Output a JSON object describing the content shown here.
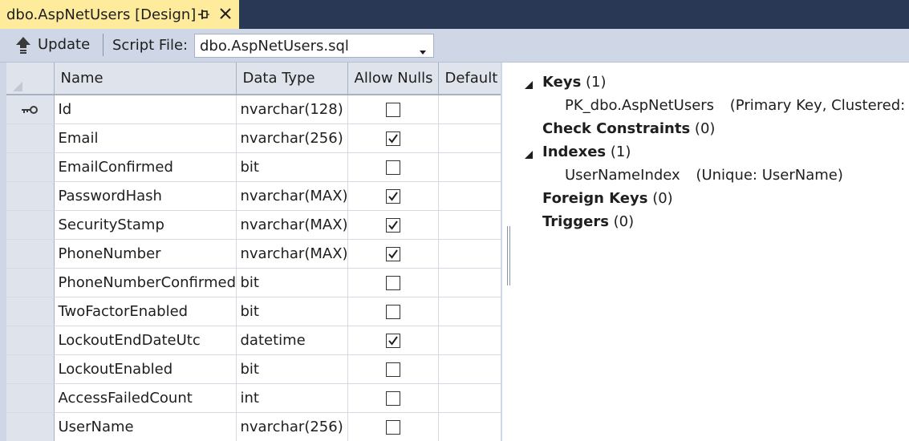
{
  "tab": {
    "title": "dbo.AspNetUsers [Design]",
    "pin_icon": "pin-icon",
    "close_icon": "close-icon"
  },
  "toolbar": {
    "update_label": "Update",
    "update_icon": "upload-arrow-icon",
    "script_file_label": "Script File:",
    "script_file_value": "dbo.AspNetUsers.sql"
  },
  "grid": {
    "headers": {
      "name": "Name",
      "data_type": "Data Type",
      "allow_nulls": "Allow Nulls",
      "default": "Default"
    },
    "rows": [
      {
        "name": "Id",
        "type": "nvarchar(128)",
        "nulls": false,
        "key": true
      },
      {
        "name": "Email",
        "type": "nvarchar(256)",
        "nulls": true,
        "key": false
      },
      {
        "name": "EmailConfirmed",
        "type": "bit",
        "nulls": false,
        "key": false
      },
      {
        "name": "PasswordHash",
        "type": "nvarchar(MAX)",
        "nulls": true,
        "key": false
      },
      {
        "name": "SecurityStamp",
        "type": "nvarchar(MAX)",
        "nulls": true,
        "key": false
      },
      {
        "name": "PhoneNumber",
        "type": "nvarchar(MAX)",
        "nulls": true,
        "key": false
      },
      {
        "name": "PhoneNumberConfirmed",
        "type": "bit",
        "nulls": false,
        "key": false
      },
      {
        "name": "TwoFactorEnabled",
        "type": "bit",
        "nulls": false,
        "key": false
      },
      {
        "name": "LockoutEndDateUtc",
        "type": "datetime",
        "nulls": true,
        "key": false
      },
      {
        "name": "LockoutEnabled",
        "type": "bit",
        "nulls": false,
        "key": false
      },
      {
        "name": "AccessFailedCount",
        "type": "int",
        "nulls": false,
        "key": false
      },
      {
        "name": "UserName",
        "type": "nvarchar(256)",
        "nulls": false,
        "key": false
      }
    ]
  },
  "properties": {
    "keys": {
      "label": "Keys",
      "count": "(1)",
      "item_name": "PK_dbo.AspNetUsers",
      "item_detail": "(Primary Key, Clustered: Id)"
    },
    "check_constraints": {
      "label": "Check Constraints",
      "count": "(0)"
    },
    "indexes": {
      "label": "Indexes",
      "count": "(1)",
      "item_name": "UserNameIndex",
      "item_detail": "(Unique: UserName)"
    },
    "foreign_keys": {
      "label": "Foreign Keys",
      "count": "(0)"
    },
    "triggers": {
      "label": "Triggers",
      "count": "(0)"
    }
  },
  "colors": {
    "tab_active": "#ffeb9c",
    "tabstrip": "#293955",
    "toolbar": "#cfd6e5",
    "grid_header": "#dfe3ec"
  }
}
